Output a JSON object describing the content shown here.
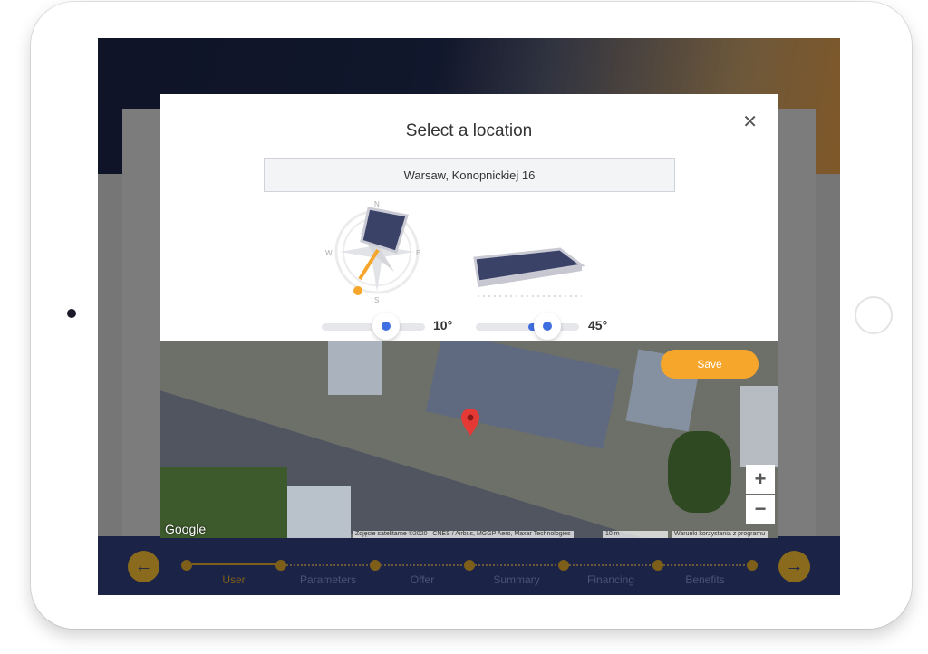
{
  "modal": {
    "title": "Select a location",
    "close_icon": "close-icon",
    "address": "Warsaw, Konopnickiej 16",
    "save_label": "Save"
  },
  "compass": {
    "n": "N",
    "e": "E",
    "s": "S",
    "w": "W"
  },
  "azimuth": {
    "value": "10°",
    "fraction": 0.62
  },
  "tilt": {
    "value": "45°",
    "fraction": 0.69
  },
  "map": {
    "logo": "Google",
    "attribution": "Zdjęcie satelitarne ©2020 , CNES / Airbus, MGGP Aero, Maxar Technologies",
    "scale": "10 m",
    "terms": "Warunki korzystania z programu",
    "zoom_in": "+",
    "zoom_out": "−"
  },
  "nav": {
    "prev_icon": "arrow-left-icon",
    "next_icon": "arrow-right-icon",
    "steps": [
      "User",
      "Parameters",
      "Offer",
      "Summary",
      "Financing",
      "Benefits"
    ],
    "active": "User"
  },
  "colors": {
    "accent": "#f7a62c",
    "navy": "#1b2447",
    "slider": "#3f6fe0"
  }
}
